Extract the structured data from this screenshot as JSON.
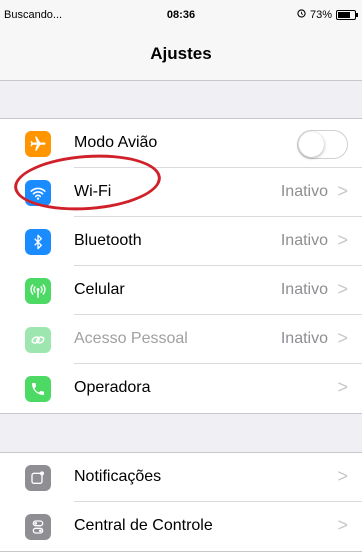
{
  "status": {
    "carrier": "Buscando...",
    "time": "08:36",
    "battery": "73%"
  },
  "nav": {
    "title": "Ajustes"
  },
  "settings": [
    {
      "label": "Modo Avião",
      "value": "",
      "icon": "airplane-icon",
      "color": "#ff9500",
      "type": "toggle",
      "toggle_on": false
    },
    {
      "label": "Wi-Fi",
      "value": "Inativo",
      "icon": "wifi-icon",
      "color": "#1a8cff",
      "type": "link"
    },
    {
      "label": "Bluetooth",
      "value": "Inativo",
      "icon": "bluetooth-icon",
      "color": "#1a8cff",
      "type": "link"
    },
    {
      "label": "Celular",
      "value": "Inativo",
      "icon": "cellular-icon",
      "color": "#4cd964",
      "type": "link"
    },
    {
      "label": "Acesso Pessoal",
      "value": "Inativo",
      "icon": "personal-hotspot-icon",
      "color": "#9ee6b0",
      "type": "link",
      "disabled": true
    },
    {
      "label": "Operadora",
      "value": "",
      "icon": "phone-icon",
      "color": "#4cd964",
      "type": "link"
    }
  ],
  "settings2": [
    {
      "label": "Notificações",
      "icon": "notifications-icon",
      "color": "#8e8e93"
    },
    {
      "label": "Central de Controle",
      "icon": "control-center-icon",
      "color": "#8e8e93"
    }
  ],
  "chevron": ">",
  "annotation_color": "#d0202a"
}
